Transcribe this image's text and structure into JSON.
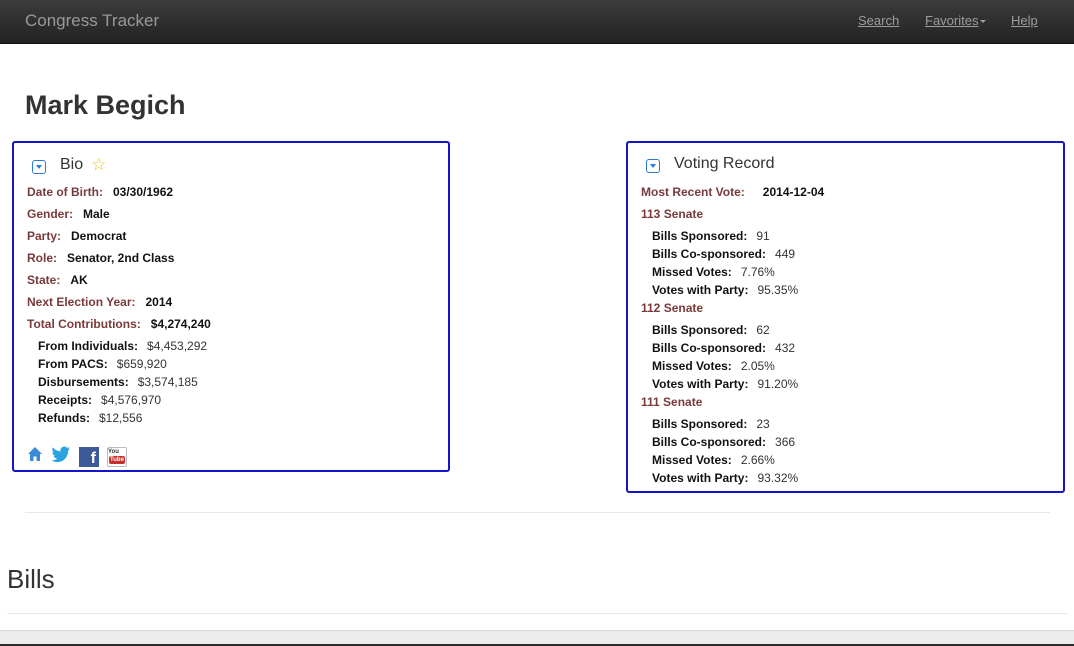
{
  "navbar": {
    "brand": "Congress Tracker",
    "search": "Search",
    "favorites": "Favorites",
    "help": "Help"
  },
  "page_title": "Mark Begich",
  "bio": {
    "title": "Bio",
    "rows": [
      {
        "label": "Date of Birth:",
        "value": "03/30/1962"
      },
      {
        "label": "Gender:",
        "value": "Male"
      },
      {
        "label": "Party:",
        "value": "Democrat"
      },
      {
        "label": "Role:",
        "value": "Senator, 2nd Class"
      },
      {
        "label": "State:",
        "value": "AK"
      },
      {
        "label": "Next Election Year:",
        "value": "2014"
      },
      {
        "label": "Total Contributions:",
        "value": "$4,274,240"
      }
    ],
    "contributions": [
      {
        "label": "From Individuals:",
        "value": "$4,453,292"
      },
      {
        "label": "From PACS:",
        "value": "$659,920"
      },
      {
        "label": "Disbursements:",
        "value": "$3,574,185"
      },
      {
        "label": "Receipts:",
        "value": "$4,576,970"
      },
      {
        "label": "Refunds:",
        "value": "$12,556"
      }
    ],
    "social_icons": [
      "home-icon",
      "twitter-icon",
      "facebook-icon",
      "youtube-icon"
    ],
    "youtube_top": "You",
    "youtube_bottom": "Tube",
    "facebook_letter": "f"
  },
  "voting": {
    "title": "Voting Record",
    "most_recent_label": "Most Recent Vote:",
    "most_recent_value": "2014-12-04",
    "sessions": [
      {
        "name": "113 Senate",
        "stats": [
          {
            "label": "Bills Sponsored:",
            "value": "91"
          },
          {
            "label": "Bills Co-sponsored:",
            "value": "449"
          },
          {
            "label": "Missed Votes:",
            "value": "7.76%"
          },
          {
            "label": "Votes with Party:",
            "value": "95.35%"
          }
        ]
      },
      {
        "name": "112 Senate",
        "stats": [
          {
            "label": "Bills Sponsored:",
            "value": "62"
          },
          {
            "label": "Bills Co-sponsored:",
            "value": "432"
          },
          {
            "label": "Missed Votes:",
            "value": "2.05%"
          },
          {
            "label": "Votes with Party:",
            "value": "91.20%"
          }
        ]
      },
      {
        "name": "111 Senate",
        "stats": [
          {
            "label": "Bills Sponsored:",
            "value": "23"
          },
          {
            "label": "Bills Co-sponsored:",
            "value": "366"
          },
          {
            "label": "Missed Votes:",
            "value": "2.66%"
          },
          {
            "label": "Votes with Party:",
            "value": "93.32%"
          }
        ]
      }
    ]
  },
  "bills_title": "Bills",
  "colors": {
    "panel_border": "#1515c8",
    "label": "#7a3a3a",
    "navbar": "#222222",
    "star": "#f2c200"
  }
}
